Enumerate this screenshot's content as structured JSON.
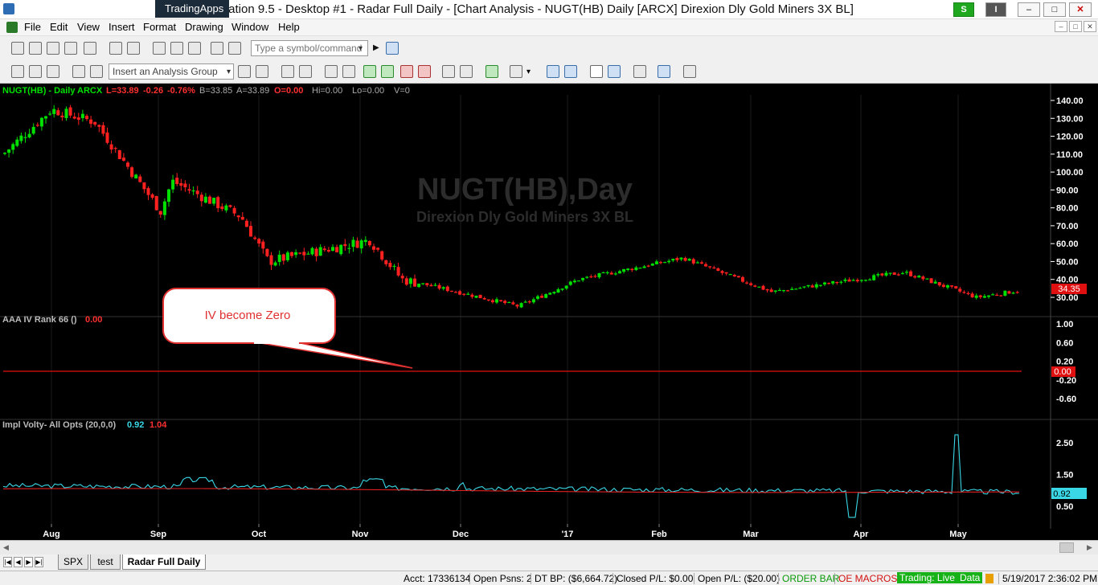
{
  "window": {
    "overlay_label": "TradingApps",
    "title": "Station 9.5 - Desktop #1 - Radar Full Daily - [Chart Analysis - NUGT(HB) Daily [ARCX] Direxion Dly Gold Miners 3X BL]",
    "s_button": "S",
    "i_button": "I",
    "minimize": "–",
    "maximize": "□",
    "close": "✕"
  },
  "menu": [
    "File",
    "Edit",
    "View",
    "Insert",
    "Format",
    "Drawing",
    "Window",
    "Help"
  ],
  "mdi": [
    "–",
    "□",
    "✕"
  ],
  "toolbar": {
    "symbol_placeholder": "Type a symbol/command",
    "analysis_group": "Insert an Analysis Group"
  },
  "chart": {
    "header": {
      "symbol": "NUGT(HB) - Daily",
      "exchange": "ARCX",
      "last": "L=33.89",
      "change": "-0.26",
      "pct": "-0.76%",
      "bid": "B=33.85",
      "ask": "A=33.89",
      "open": "O=0.00",
      "hi": "Hi=0.00",
      "lo": "Lo=0.00",
      "vol": "V=0"
    },
    "watermark_symbol": "NUGT(HB),Day",
    "watermark_name": "Direxion Dly Gold Miners 3X BL",
    "price_axis": [
      "140.00",
      "130.00",
      "120.00",
      "110.00",
      "100.00",
      "90.00",
      "80.00",
      "70.00",
      "60.00",
      "50.00",
      "40.00",
      "30.00"
    ],
    "price_tag": "34.35",
    "colors": {
      "up": "#00e000",
      "down": "#ff2020",
      "iv": "#3ad7e6",
      "avg": "#e02020",
      "axis": "#ffffff"
    },
    "ivrank": {
      "label": "AAA IV Rank 66 ()",
      "value": "0.00",
      "axis": [
        "1.00",
        "0.60",
        "0.20",
        "-0.20",
        "-0.60"
      ],
      "tag": "0.00"
    },
    "implvol": {
      "label": "Impl Volty- All Opts (20,0,0)",
      "value1": "0.92",
      "value2": "1.04",
      "axis": [
        "2.50",
        "1.50",
        "0.50"
      ],
      "tag": "0.92"
    },
    "x_axis": [
      "Aug",
      "Sep",
      "Oct",
      "Nov",
      "Dec",
      "'17",
      "Feb",
      "Mar",
      "Apr",
      "May"
    ],
    "callout": "IV become Zero"
  },
  "chart_data": {
    "type": "candlestick",
    "y_axis": {
      "min": 30,
      "max": 140
    },
    "approx_close_path": [
      {
        "x": "Jul",
        "close": 110
      },
      {
        "x": "Aug",
        "close": 135
      },
      {
        "x": "Aug",
        "close": 128
      },
      {
        "x": "Sep",
        "close": 78
      },
      {
        "x": "Sep",
        "close": 95
      },
      {
        "x": "Oct",
        "close": 75
      },
      {
        "x": "Oct",
        "close": 50
      },
      {
        "x": "Nov",
        "close": 62
      },
      {
        "x": "Nov",
        "close": 40
      },
      {
        "x": "Dec",
        "close": 34
      },
      {
        "x": "Dec",
        "close": 25
      },
      {
        "x": "'17",
        "close": 40
      },
      {
        "x": "Feb",
        "close": 52
      },
      {
        "x": "Mar",
        "close": 33
      },
      {
        "x": "Apr",
        "close": 44
      },
      {
        "x": "May",
        "close": 30
      },
      {
        "x": "May",
        "close": 34
      }
    ]
  },
  "tabs": [
    "SPX",
    "test",
    "Radar Full Daily"
  ],
  "status": {
    "acct": "Acct: 17336134",
    "open_psns": "Open Psns: 2",
    "dt_bp": "DT BP: ($6,664.72)",
    "closed_pl": "Closed P/L: $0.00",
    "open_pl": "Open P/L: ($20.00)",
    "order_bar": "ORDER BAR",
    "oe_macros": "OE MACROS",
    "trading": "Trading: Live",
    "data": "Data",
    "datetime": "5/19/2017 2:36:02 PM"
  }
}
